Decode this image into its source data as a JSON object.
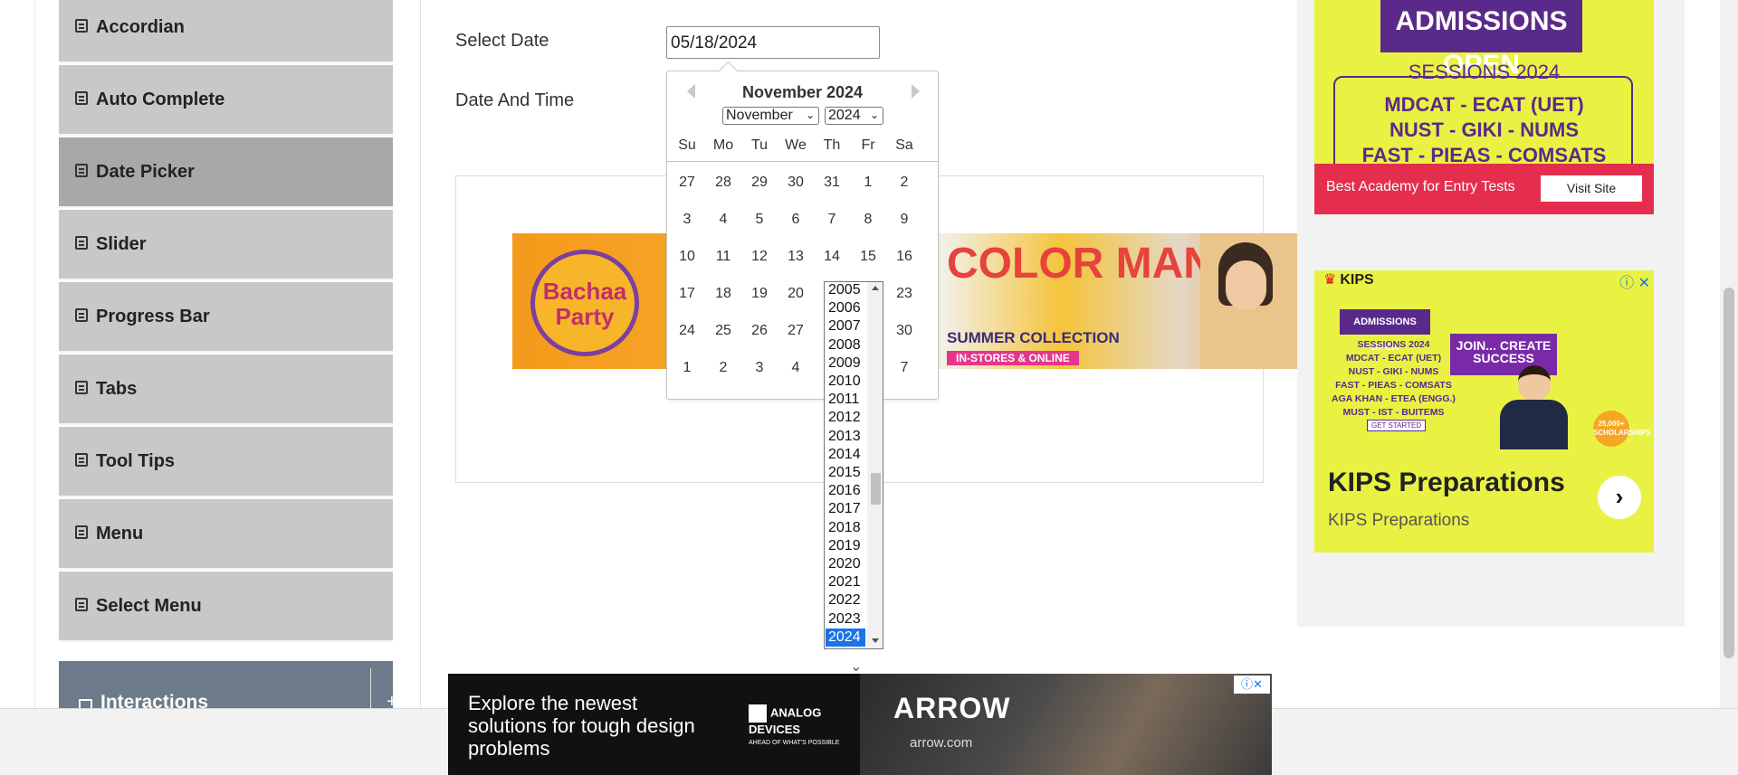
{
  "sidebar": {
    "items": [
      {
        "label": "Accordian",
        "icon": "list-icon"
      },
      {
        "label": "Auto Complete",
        "icon": "list-icon"
      },
      {
        "label": "Date Picker",
        "icon": "list-icon",
        "active": true
      },
      {
        "label": "Slider",
        "icon": "list-icon"
      },
      {
        "label": "Progress Bar",
        "icon": "list-icon"
      },
      {
        "label": "Tabs",
        "icon": "list-icon"
      },
      {
        "label": "Tool Tips",
        "icon": "list-icon"
      },
      {
        "label": "Menu",
        "icon": "list-icon"
      },
      {
        "label": "Select Menu",
        "icon": "list-icon"
      }
    ],
    "group": {
      "label": "Interactions",
      "toggle": "+"
    }
  },
  "form": {
    "select_date_label": "Select Date",
    "select_date_value": "05/18/2024",
    "date_time_label": "Date And Time"
  },
  "datepicker": {
    "title": "November 2024",
    "month_select": "November",
    "year_select": "2024",
    "days_of_week": [
      "Su",
      "Mo",
      "Tu",
      "We",
      "Th",
      "Fr",
      "Sa"
    ],
    "weeks": [
      [
        "27",
        "28",
        "29",
        "30",
        "31",
        "1",
        "2"
      ],
      [
        "3",
        "4",
        "5",
        "6",
        "7",
        "8",
        "9"
      ],
      [
        "10",
        "11",
        "12",
        "13",
        "14",
        "15",
        "16"
      ],
      [
        "17",
        "18",
        "19",
        "20",
        "",
        "",
        "23"
      ],
      [
        "24",
        "25",
        "26",
        "27",
        "",
        "",
        "30"
      ],
      [
        "1",
        "2",
        "3",
        "4",
        "",
        "",
        "7"
      ]
    ],
    "year_options": [
      "2005",
      "2006",
      "2007",
      "2008",
      "2009",
      "2010",
      "2011",
      "2012",
      "2013",
      "2014",
      "2015",
      "2016",
      "2017",
      "2018",
      "2019",
      "2020",
      "2021",
      "2022",
      "2023",
      "2024"
    ],
    "selected_year": "2024"
  },
  "banner": {
    "left_brand": "Bachaa Party",
    "headline": "COLOR MANIA",
    "subline": "SUMMER COLLECTION",
    "tagline": "IN-STORES & ONLINE"
  },
  "ad_top": {
    "headline": "ADMISSIONS OPEN",
    "session": "SESSIONS 2024",
    "lines": [
      "MDCAT - ECAT (UET)",
      "NUST - GIKI - NUMS",
      "FAST - PIEAS - COMSATS"
    ],
    "bar_text": "Best Academy for Entry Tests",
    "visit_label": "Visit Site"
  },
  "ad_kips": {
    "brand": "KIPS",
    "admissions": "ADMISSIONS OPEN",
    "lines": [
      "SESSIONS 2024",
      "MDCAT - ECAT (UET)",
      "NUST - GIKI - NUMS",
      "FAST - PIEAS - COMSATS",
      "AGA KHAN - ETEA (ENGG.)",
      "MUST - IST - BUITEMS"
    ],
    "get_started": "GET STARTED",
    "join": "JOIN... CREATE SUCCESS",
    "badge": "25,000+ SCHOLARSHIPS",
    "title": "KIPS Preparations",
    "subtitle": "KIPS Preparations"
  },
  "bottom_ad": {
    "text": "Explore the newest solutions for tough design problems",
    "logo": "ANALOG DEVICES",
    "logo_tag": "AHEAD OF WHAT'S POSSIBLE",
    "brand": "ARROW",
    "url": "arrow.com"
  },
  "colors": {
    "sidebar_item": "#c8c8c8",
    "sidebar_active": "#a8a8a8",
    "year_selected": "#1a73e8",
    "ad_yellow": "#e9f243",
    "ad_purple": "#5a2a8a",
    "ad_red": "#e52e4d"
  }
}
